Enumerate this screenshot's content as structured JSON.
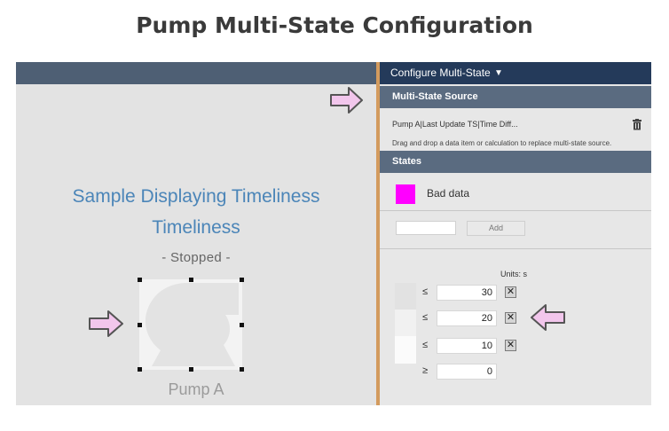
{
  "page": {
    "title": "Pump Multi-State Configuration"
  },
  "display": {
    "sample_title": "Sample Displaying Timeliness",
    "timeliness_label": "Timeliness",
    "state_text": "- Stopped -",
    "pump_name": "Pump A",
    "pump_icon": "pump-icon"
  },
  "config": {
    "header": "Configure Multi-State",
    "source_section": "Multi-State Source",
    "source_value": "Pump A|Last Update TS|Time Diff...",
    "source_hint": "Drag and drop a data item or calculation to replace multi-state source.",
    "states_section": "States",
    "state": {
      "name": "Bad data",
      "color": "#ff00ff"
    },
    "add_label": "Add",
    "units_label": "Units: s",
    "thresholds": [
      {
        "operator": "≤",
        "value": "30",
        "remove": "✕"
      },
      {
        "operator": "≤",
        "value": "20",
        "remove": "✕"
      },
      {
        "operator": "≤",
        "value": "10",
        "remove": "✕"
      },
      {
        "operator": "≥",
        "value": "0"
      }
    ]
  },
  "colors": {
    "accent_header": "#243a5a",
    "section_bar": "#5a6b80",
    "callout_arrow": "#f2c6ec",
    "splitter": "#d39b5e"
  }
}
